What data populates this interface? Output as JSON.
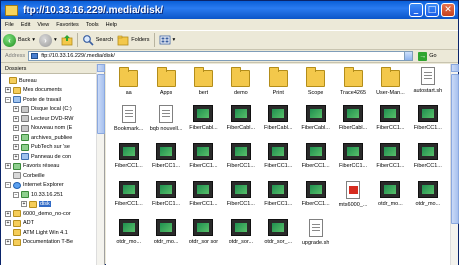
{
  "window": {
    "title": "ftp://10.33.16.229/.media/disk/",
    "buttons": [
      "_",
      "□",
      "✕"
    ]
  },
  "menu": [
    "File",
    "Edit",
    "View",
    "Favorites",
    "Tools",
    "Help"
  ],
  "toolbar": {
    "back": "Back",
    "search": "Search",
    "folders": "Folders"
  },
  "address": {
    "label": "Address",
    "value": "ftp://10.33.16.229/.media/disk/",
    "go": "Go"
  },
  "left_pane": {
    "title": "Dossiers",
    "close": "×",
    "tree": [
      {
        "label": "Bureau",
        "expander": "",
        "icon": "folder"
      },
      {
        "label": "Mes documents",
        "expander": "+",
        "icon": "folder"
      },
      {
        "label": "Poste de travail",
        "expander": "−",
        "icon": "pc"
      },
      {
        "label": "Disque local (C:)",
        "expander": "+",
        "icon": "drive"
      },
      {
        "label": "Lecteur DVD-RW",
        "expander": "+",
        "icon": "drive"
      },
      {
        "label": "Nouveau nom (E",
        "expander": "+",
        "icon": "drive"
      },
      {
        "label": "archives_publiee",
        "expander": "+",
        "icon": "net"
      },
      {
        "label": "PubTech sur 'se",
        "expander": "+",
        "icon": "net"
      },
      {
        "label": "Panneau de con",
        "expander": "+",
        "icon": "pc"
      },
      {
        "label": "Favoris réseau",
        "expander": "+",
        "icon": "net"
      },
      {
        "label": "Corbeille",
        "expander": "",
        "icon": "bin"
      },
      {
        "label": "Internet Explorer",
        "expander": "−",
        "icon": "ie"
      },
      {
        "label": "10.33.16.251",
        "expander": "−",
        "icon": "net"
      },
      {
        "label": "disk",
        "expander": "+",
        "icon": "folder",
        "selected": true
      },
      {
        "label": "6000_demo_no-cor",
        "expander": "+",
        "icon": "folder"
      },
      {
        "label": "ADT",
        "expander": "+",
        "icon": "folder"
      },
      {
        "label": "ATM Light Win 4.1",
        "expander": "",
        "icon": "folder"
      },
      {
        "label": "Documentation T-Be",
        "expander": "+",
        "icon": "folder"
      }
    ]
  },
  "files": [
    {
      "label": "aa",
      "type": "folder"
    },
    {
      "label": "Apps",
      "type": "folder"
    },
    {
      "label": "bert",
      "type": "folder"
    },
    {
      "label": "demo",
      "type": "folder"
    },
    {
      "label": "Print",
      "type": "folder"
    },
    {
      "label": "Scope",
      "type": "folder"
    },
    {
      "label": "Trace4265",
      "type": "folder"
    },
    {
      "label": "User-Man...",
      "type": "folder"
    },
    {
      "label": "autostart.sh",
      "type": "doc"
    },
    {
      "label": "Bookmark...",
      "type": "doc"
    },
    {
      "label": "bqb nouvell...",
      "type": "doc"
    },
    {
      "label": "FiberCabl...",
      "type": "media"
    },
    {
      "label": "FiberCabl...",
      "type": "media"
    },
    {
      "label": "FiberCabl...",
      "type": "media"
    },
    {
      "label": "FiberCabl...",
      "type": "media"
    },
    {
      "label": "FiberCabl...",
      "type": "media"
    },
    {
      "label": "FiberCC1...",
      "type": "media"
    },
    {
      "label": "FiberCC1...",
      "type": "media"
    },
    {
      "label": "FiberCC1...",
      "type": "media"
    },
    {
      "label": "FiberCC1...",
      "type": "media"
    },
    {
      "label": "FiberCC1...",
      "type": "media"
    },
    {
      "label": "FiberCC1...",
      "type": "media"
    },
    {
      "label": "FiberCC1...",
      "type": "media"
    },
    {
      "label": "FiberCC1...",
      "type": "media"
    },
    {
      "label": "FiberCC1...",
      "type": "media"
    },
    {
      "label": "FiberCC1...",
      "type": "media"
    },
    {
      "label": "FiberCC1...",
      "type": "media"
    },
    {
      "label": "FiberCC1...",
      "type": "media"
    },
    {
      "label": "FiberCC1...",
      "type": "media"
    },
    {
      "label": "FiberCC1...",
      "type": "media"
    },
    {
      "label": "FiberCC1...",
      "type": "media"
    },
    {
      "label": "FiberCC1...",
      "type": "media"
    },
    {
      "label": "FiberCC1...",
      "type": "media"
    },
    {
      "label": "mts6000_...",
      "type": "pdf"
    },
    {
      "label": "otdr_mo...",
      "type": "media"
    },
    {
      "label": "otdr_mo...",
      "type": "media"
    },
    {
      "label": "otdr_mo...",
      "type": "media"
    },
    {
      "label": "otdr_mo...",
      "type": "media"
    },
    {
      "label": "otdr_sor sor",
      "type": "media"
    },
    {
      "label": "otdr_sor...",
      "type": "media"
    },
    {
      "label": "otdr_sor_...",
      "type": "media"
    },
    {
      "label": "upgrade.sh",
      "type": "doc"
    }
  ]
}
